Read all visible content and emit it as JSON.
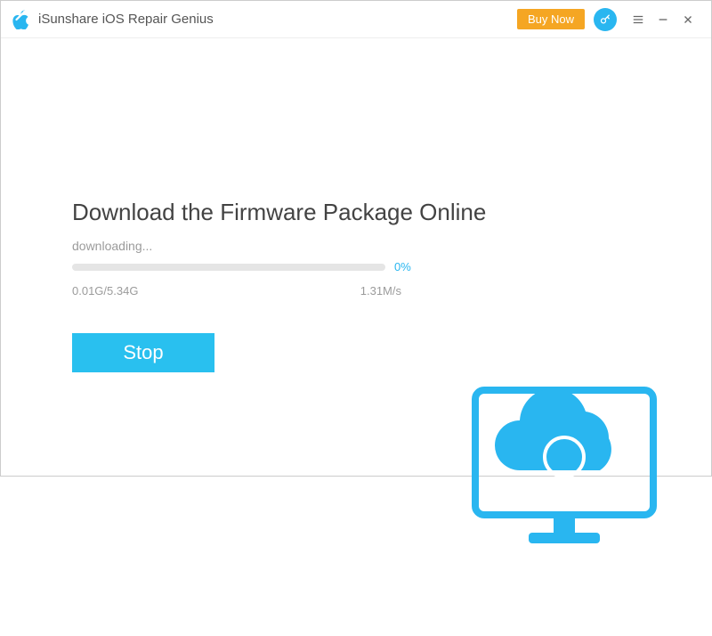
{
  "titlebar": {
    "app_name": "iSunshare iOS Repair Genius",
    "buy_now": "Buy Now"
  },
  "main": {
    "heading": "Download the Firmware Package Online",
    "status": "downloading...",
    "progress_percent": "0%",
    "downloaded_size": "0.01G/5.34G",
    "speed": "1.31M/s",
    "stop_label": "Stop"
  },
  "colors": {
    "accent": "#29b6f0",
    "buy_now_bg": "#f5a623"
  }
}
